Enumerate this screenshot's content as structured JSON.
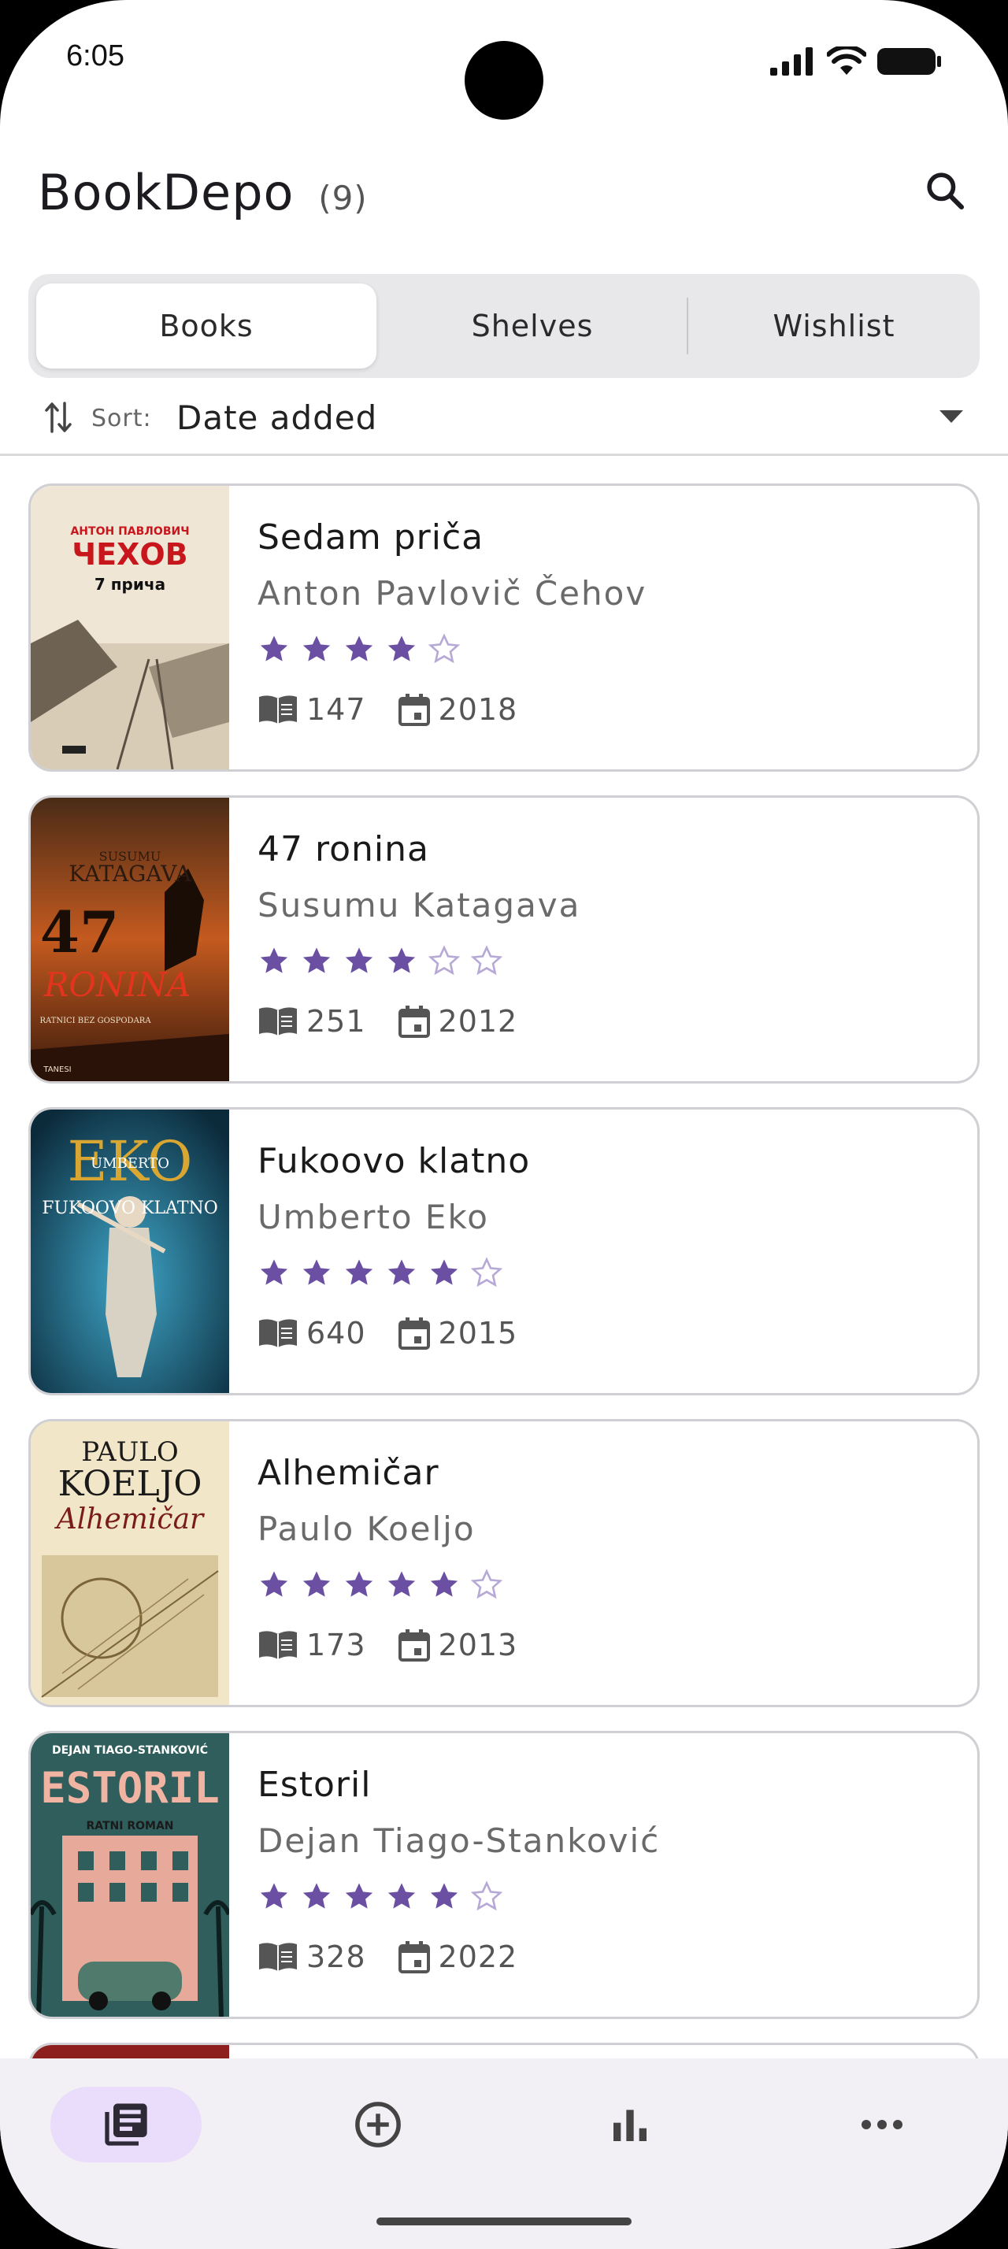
{
  "status_bar": {
    "time": "6:05"
  },
  "app_bar": {
    "title": "BookDepo",
    "count": "(9)",
    "search_icon": "search-icon"
  },
  "tabs": [
    {
      "label": "Books",
      "active": true
    },
    {
      "label": "Shelves",
      "active": false
    },
    {
      "label": "Wishlist",
      "active": false
    }
  ],
  "sort": {
    "label": "Sort:",
    "value": "Date added"
  },
  "colors": {
    "accent": "#6a4fa3",
    "accent_light": "#eaddfb",
    "star_empty": "#b7a9d6"
  },
  "books": [
    {
      "title": "Sedam priča",
      "author": "Anton Pavlovič Čehov",
      "rating": 4,
      "max_rating": 5,
      "pages": "147",
      "year": "2018"
    },
    {
      "title": "47 ronina",
      "author": "Susumu Katagava",
      "rating": 4,
      "max_rating": 6,
      "pages": "251",
      "year": "2012"
    },
    {
      "title": "Fukoovo klatno",
      "author": "Umberto Eko",
      "rating": 5,
      "max_rating": 6,
      "pages": "640",
      "year": "2015"
    },
    {
      "title": "Alhemičar",
      "author": "Paulo Koeljo",
      "rating": 5,
      "max_rating": 6,
      "pages": "173",
      "year": "2013"
    },
    {
      "title": "Estoril",
      "author": "Dejan Tiago-Stanković",
      "rating": 5,
      "max_rating": 6,
      "pages": "328",
      "year": "2022"
    }
  ],
  "covers": [
    {
      "top_text": "АНТОН ПАВЛОВИЧ",
      "main_text": "ЧЕХОВ",
      "sub_text": "7 прича"
    },
    {
      "top_text": "SUSUMU",
      "main_text": "KATAGAVA",
      "sub_text": "RONINA",
      "number": "47",
      "foot_text": "RATNICI BEZ GOSPODARA",
      "publisher": "TANESI"
    },
    {
      "top_text": "UMBERTO",
      "main_text": "EKO",
      "sub_text": "FUKOOVO KLATNO"
    },
    {
      "top_text": "PAULO",
      "main_text": "KOELJO",
      "sub_text": "Alhemičar"
    },
    {
      "top_text": "DEJAN TIAGO-STANKOVIĆ",
      "main_text": "ESTORIL",
      "sub_text": "RATNI ROMAN"
    }
  ],
  "bottom_nav": [
    {
      "icon": "library-books-icon",
      "active": true
    },
    {
      "icon": "add-circle-icon",
      "active": false
    },
    {
      "icon": "bar-chart-icon",
      "active": false
    },
    {
      "icon": "more-horiz-icon",
      "active": false
    }
  ]
}
